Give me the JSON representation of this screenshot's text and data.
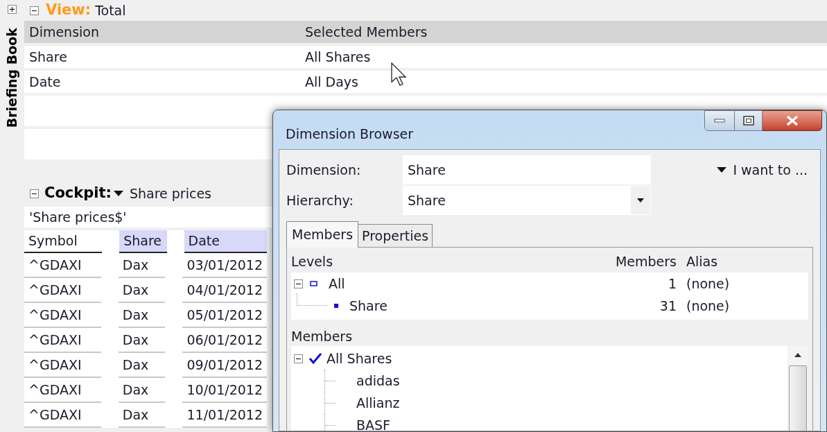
{
  "sidebar": {
    "expanded": false,
    "title": "Briefing Book"
  },
  "view": {
    "expanded": true,
    "label": "View:",
    "name": "Total",
    "columns": [
      "Dimension",
      "Selected Members"
    ],
    "rows": [
      [
        "Share",
        "All Shares"
      ],
      [
        "Date",
        "All Days"
      ]
    ]
  },
  "cockpit": {
    "expanded": true,
    "label": "Cockpit:",
    "name": "Share prices",
    "source": "'Share prices$'",
    "columns": [
      {
        "label": "Symbol",
        "highlighted": false
      },
      {
        "label": "Share",
        "highlighted": true
      },
      {
        "label": "Date",
        "highlighted": true
      }
    ],
    "rows": [
      [
        "^GDAXI",
        "Dax",
        "03/01/2012"
      ],
      [
        "^GDAXI",
        "Dax",
        "04/01/2012"
      ],
      [
        "^GDAXI",
        "Dax",
        "05/01/2012"
      ],
      [
        "^GDAXI",
        "Dax",
        "06/01/2012"
      ],
      [
        "^GDAXI",
        "Dax",
        "09/01/2012"
      ],
      [
        "^GDAXI",
        "Dax",
        "10/01/2012"
      ],
      [
        "^GDAXI",
        "Dax",
        "11/01/2012"
      ]
    ]
  },
  "dialog": {
    "title": "Dimension Browser",
    "dimension_label": "Dimension:",
    "dimension_value": "Share",
    "action": "I want to ...",
    "hierarchy_label": "Hierarchy:",
    "hierarchy_value": "Share",
    "tabs": [
      {
        "label": "Members",
        "selected": true
      },
      {
        "label": "Properties",
        "selected": false
      }
    ],
    "levels": {
      "columns": [
        "Levels",
        "Members",
        "Alias"
      ],
      "items": [
        {
          "name": "All",
          "members": "1",
          "alias": "(none)",
          "expanded": true,
          "children": [
            {
              "name": "Share",
              "members": "31",
              "alias": "(none)"
            }
          ]
        }
      ]
    },
    "members": {
      "label": "Members",
      "items": [
        {
          "name": "All Shares",
          "checked": true,
          "expanded": true,
          "children": [
            {
              "name": "adidas"
            },
            {
              "name": "Allianz"
            },
            {
              "name": "BASF"
            }
          ]
        }
      ]
    }
  }
}
